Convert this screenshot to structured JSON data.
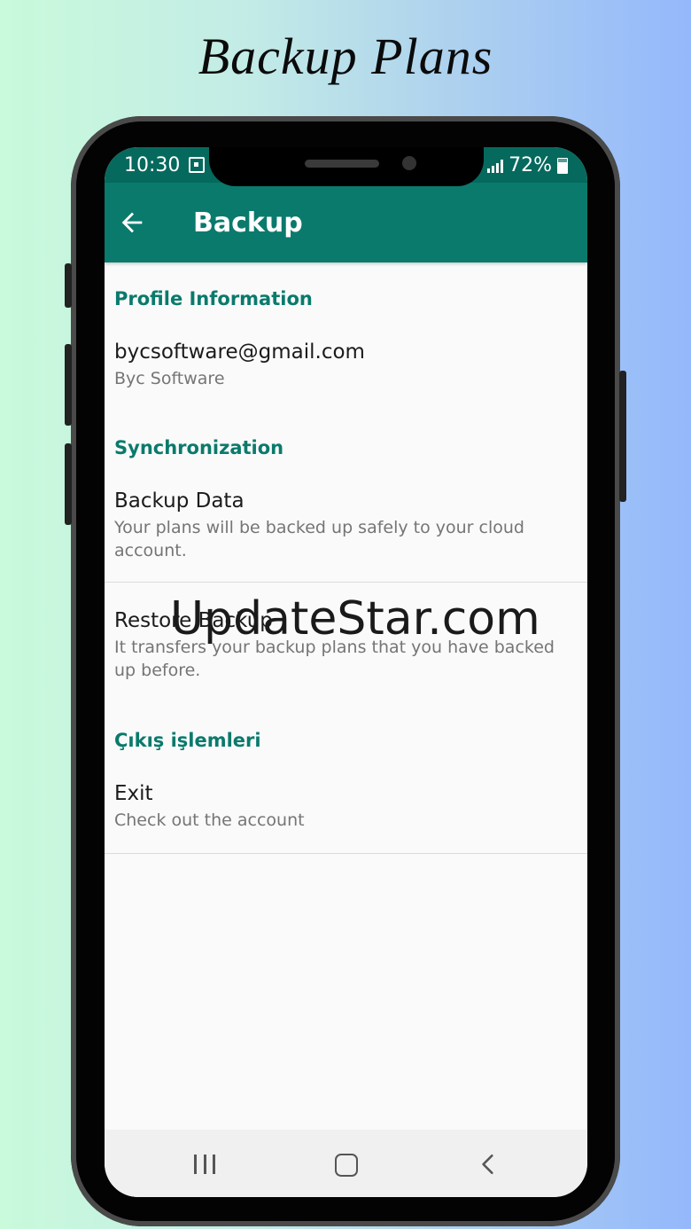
{
  "headline": "Backup Plans",
  "status_bar": {
    "time": "10:30",
    "battery": "72%",
    "calendar_icon": "calendar-icon",
    "signal_icon": "signal-icon",
    "battery_icon": "battery-icon"
  },
  "app_bar": {
    "title": "Backup",
    "back_icon": "arrow-back-icon",
    "color": "#0a7a6c"
  },
  "profile": {
    "header": "Profile Information",
    "email": "bycsoftware@gmail.com",
    "name": "Byc Software"
  },
  "sync": {
    "header": "Synchronization",
    "backup_title": "Backup Data",
    "backup_summary": "Your plans will be backed up safely to your cloud account.",
    "restore_title": "Restore Backup",
    "restore_summary": "It transfers your backup plans that you have backed up before."
  },
  "exit_section": {
    "header": "Çıkış işlemleri",
    "exit_title": "Exit",
    "exit_summary": "Check out the account"
  },
  "watermark": "UpdateStar.com",
  "nav_bar": {
    "recents_icon": "recents-icon",
    "home_icon": "home-icon",
    "back_icon": "back-chevron-icon"
  }
}
